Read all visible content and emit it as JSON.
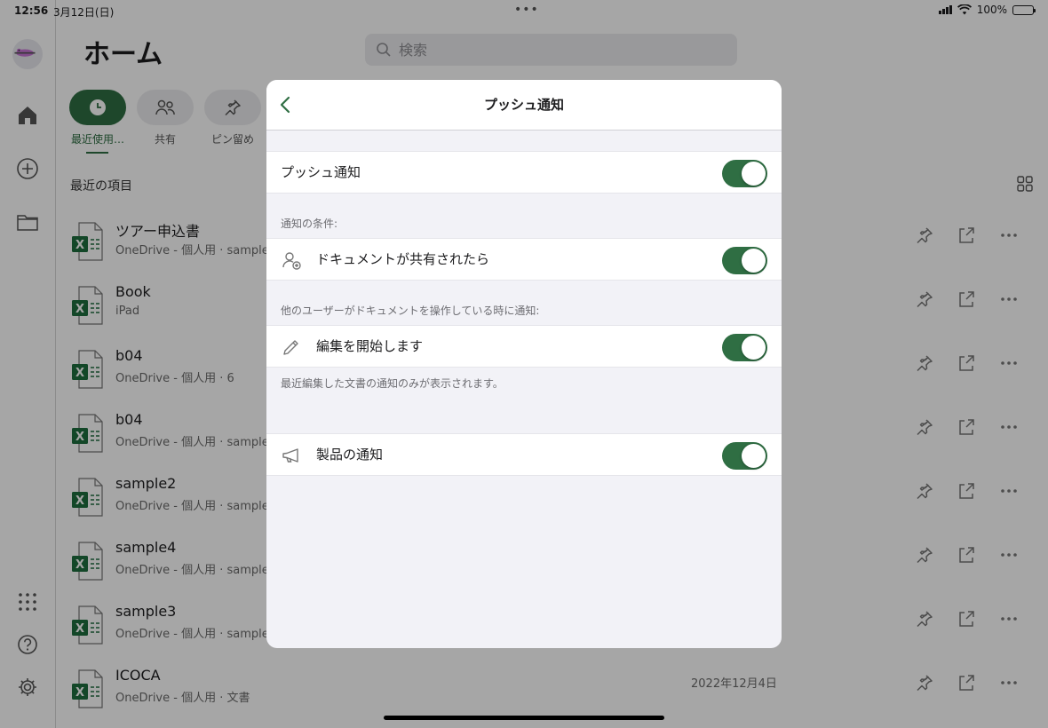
{
  "status_bar": {
    "time": "12:56",
    "date": "3月12日(日)",
    "multitask": "•••",
    "battery_percent": "100%"
  },
  "rail": {
    "icons": [
      "home-icon",
      "add-icon",
      "folder-icon",
      "apps-icon",
      "help-icon",
      "settings-icon"
    ]
  },
  "main": {
    "title": "ホーム",
    "search_placeholder": "検索",
    "filters": [
      {
        "label": "最近使用…",
        "icon": "clock-icon",
        "active": true
      },
      {
        "label": "共有",
        "icon": "people-icon",
        "active": false
      },
      {
        "label": "ピン留め",
        "icon": "pin-icon",
        "active": false
      }
    ],
    "section_title": "最近の項目",
    "files": [
      {
        "name": "ツアー申込書",
        "location": "OneDrive - 個人用 · sample",
        "date": ""
      },
      {
        "name": "Book",
        "location": "iPad",
        "date": ""
      },
      {
        "name": "b04",
        "location": "OneDrive - 個人用 · 6",
        "date": ""
      },
      {
        "name": "b04",
        "location": "OneDrive - 個人用 · sample",
        "date": ""
      },
      {
        "name": "sample2",
        "location": "OneDrive - 個人用 · sample",
        "date": ""
      },
      {
        "name": "sample4",
        "location": "OneDrive - 個人用 · sample",
        "date": ""
      },
      {
        "name": "sample3",
        "location": "OneDrive - 個人用 · sample",
        "date": ""
      },
      {
        "name": "ICOCA",
        "location": "OneDrive - 個人用 · 文書",
        "date": "2022年12月4日"
      }
    ],
    "file_badge": "X"
  },
  "sheet": {
    "title": "プッシュ通知",
    "rows": {
      "push": {
        "label": "プッシュ通知",
        "on": true
      },
      "shared": {
        "label": "ドキュメントが共有されたら",
        "on": true
      },
      "editing": {
        "label": "編集を開始します",
        "on": true
      },
      "product": {
        "label": "製品の通知",
        "on": true
      }
    },
    "section_conditions": "通知の条件:",
    "section_others": "他のユーザーがドキュメントを操作している時に通知:",
    "footer_note": "最近編集した文書の通知のみが表示されます。"
  },
  "colors": {
    "accent": "#2f6e43",
    "background": "#f2f2f7"
  }
}
